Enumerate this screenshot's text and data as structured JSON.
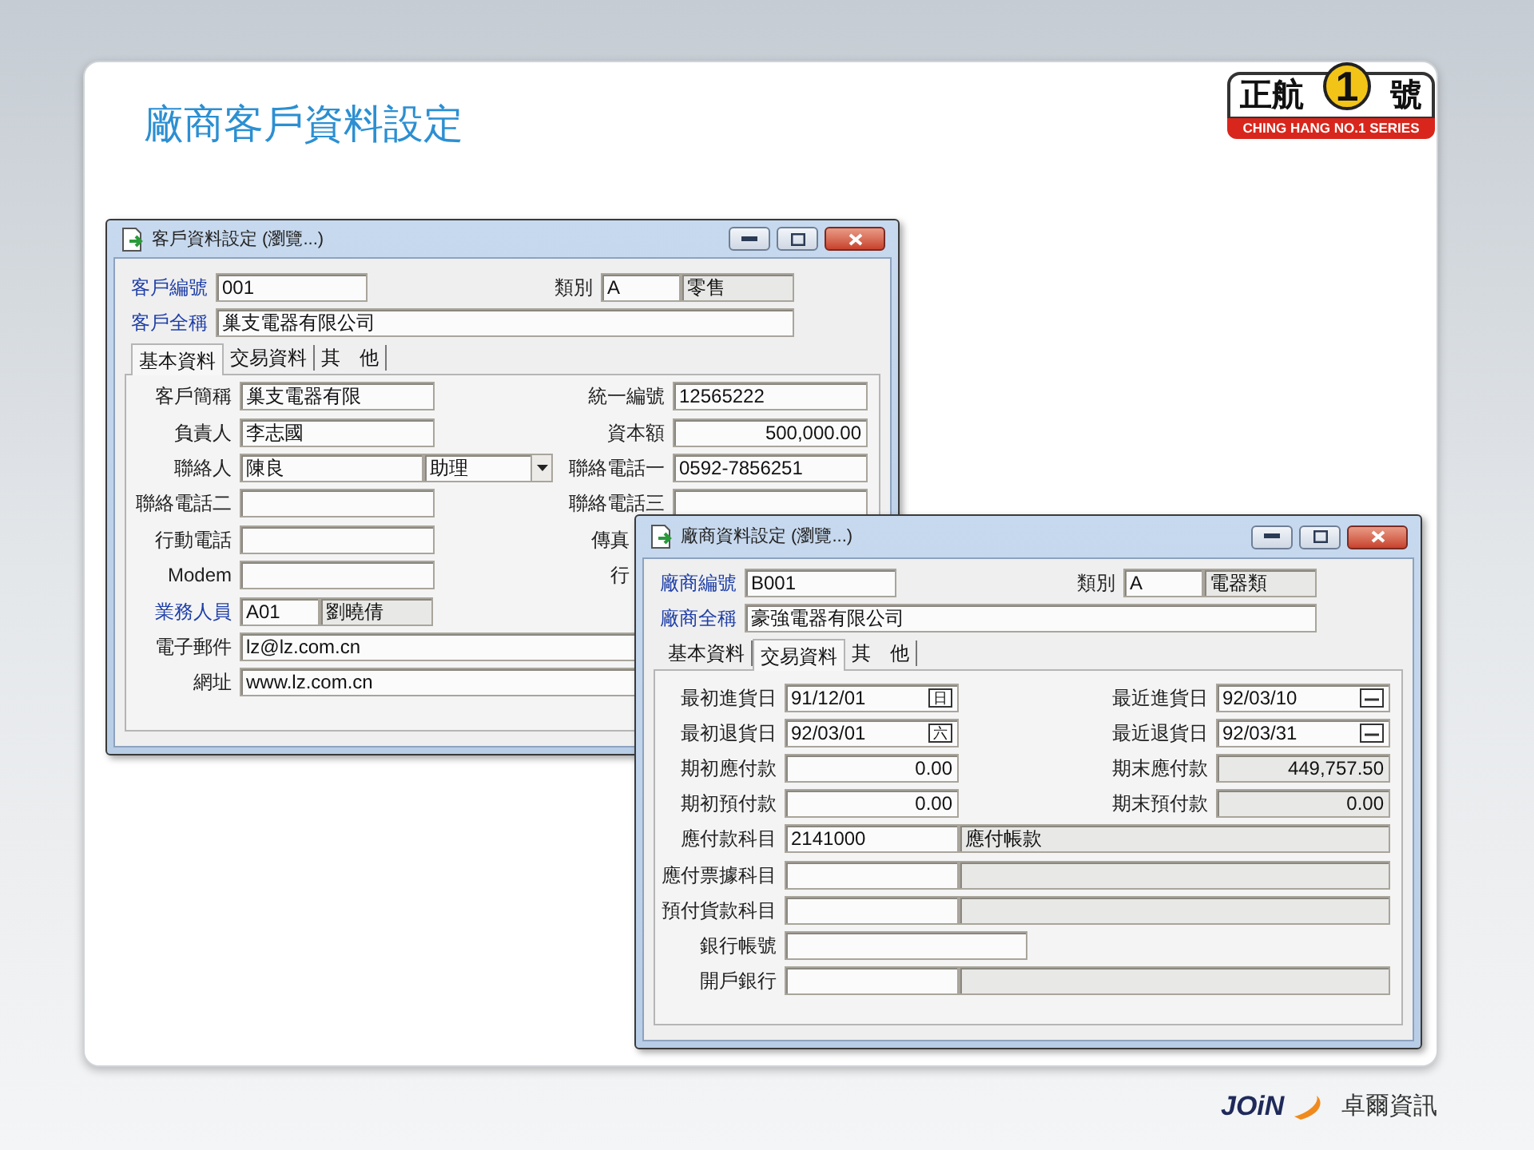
{
  "slide": {
    "title": "廠商客戶資料設定"
  },
  "logo": {
    "brand": "正航",
    "number": "1",
    "suffix": "號",
    "tagline": "CHING HANG NO.1 SERIES"
  },
  "windows": [
    {
      "kind": "customer",
      "title": "客戶資料設定 (瀏覽...)",
      "header": [
        {
          "left": {
            "label": "客戶編號",
            "linked": true,
            "fields": [
              {
                "kind": "id",
                "value": "001",
                "readonly": false
              }
            ]
          },
          "right": {
            "label": "類別",
            "linked": false,
            "fields": [
              {
                "kind": "code",
                "value": "A",
                "readonly": false
              },
              {
                "kind": "name",
                "value": "零售",
                "readonly": true
              }
            ]
          }
        },
        {
          "left": {
            "label": "客戶全稱",
            "linked": true,
            "fields": [
              {
                "kind": "wide",
                "value": "巢支電器有限公司",
                "readonly": false
              }
            ]
          }
        }
      ],
      "tabs": [
        {
          "label": "基本資料",
          "selected": true
        },
        {
          "label": "交易資料",
          "selected": false
        },
        {
          "label": "其　他",
          "selected": false
        }
      ],
      "rows": [
        {
          "left": {
            "label": "客戶簡稱",
            "linked": false,
            "fields": [
              {
                "kind": "text",
                "value": "巢支電器有限",
                "readonly": false
              }
            ]
          },
          "right": {
            "label": "統一編號",
            "linked": false,
            "fields": [
              {
                "kind": "text",
                "value": "12565222",
                "readonly": false
              }
            ]
          }
        },
        {
          "left": {
            "label": "負責人",
            "linked": false,
            "fields": [
              {
                "kind": "text",
                "value": "李志國",
                "readonly": false
              }
            ]
          },
          "right": {
            "label": "資本額",
            "linked": false,
            "fields": [
              {
                "kind": "amount",
                "value": "500,000.00",
                "readonly": false
              }
            ]
          }
        },
        {
          "left": {
            "label": "聯絡人",
            "linked": false,
            "fields": [
              {
                "kind": "text",
                "value": "陳良",
                "readonly": false
              },
              {
                "kind": "select",
                "value": "助理",
                "readonly": false
              }
            ]
          },
          "right": {
            "label": "聯絡電話一",
            "linked": false,
            "fields": [
              {
                "kind": "text",
                "value": "0592-7856251",
                "readonly": false
              }
            ]
          }
        },
        {
          "left": {
            "label": "聯絡電話二",
            "linked": false,
            "fields": [
              {
                "kind": "text",
                "readonly": false
              }
            ]
          },
          "right": {
            "label": "聯絡電話三",
            "linked": false,
            "fields": [
              {
                "kind": "text",
                "readonly": false
              }
            ]
          }
        },
        {
          "left": {
            "label": "行動電話",
            "linked": false,
            "fields": [
              {
                "kind": "text",
                "readonly": false
              }
            ]
          },
          "right": {
            "label": "傳真",
            "linked": false
          }
        },
        {
          "left": {
            "label": "Modem",
            "linked": false,
            "fields": [
              {
                "kind": "text",
                "readonly": false
              }
            ]
          },
          "right": {
            "label": "行",
            "linked": false
          }
        },
        {
          "left": {
            "label": "業務人員",
            "linked": true,
            "fields": [
              {
                "kind": "code",
                "value": "A01",
                "readonly": false
              },
              {
                "kind": "name",
                "value": "劉曉倩",
                "readonly": true
              }
            ]
          }
        },
        {
          "left": {
            "label": "電子郵件",
            "linked": false,
            "fields": [
              {
                "kind": "wide",
                "value": "lz@lz.com.cn",
                "readonly": false
              }
            ]
          }
        },
        {
          "left": {
            "label": "網址",
            "linked": false,
            "fields": [
              {
                "kind": "wide",
                "value": "www.lz.com.cn",
                "readonly": false
              }
            ]
          }
        }
      ]
    },
    {
      "kind": "vendor",
      "title": "廠商資料設定 (瀏覽...)",
      "header": [
        {
          "left": {
            "label": "廠商編號",
            "linked": true,
            "fields": [
              {
                "kind": "id",
                "value": "B001",
                "readonly": false
              }
            ]
          },
          "right": {
            "label": "類別",
            "linked": false,
            "fields": [
              {
                "kind": "code",
                "value": "A",
                "readonly": false
              },
              {
                "kind": "name",
                "value": "電器類",
                "readonly": true
              }
            ]
          }
        },
        {
          "left": {
            "label": "廠商全稱",
            "linked": true,
            "fields": [
              {
                "kind": "wide",
                "value": "豪強電器有限公司",
                "readonly": false
              }
            ]
          }
        }
      ],
      "tabs": [
        {
          "label": "基本資料",
          "selected": false
        },
        {
          "label": "交易資料",
          "selected": true
        },
        {
          "label": "其　他",
          "selected": false
        }
      ],
      "rows": [
        {
          "left": {
            "label": "最初進貨日",
            "linked": false,
            "fields": [
              {
                "kind": "date",
                "value": "91/12/01",
                "weekday": "日",
                "readonly": false
              }
            ]
          },
          "right": {
            "label": "最近進貨日",
            "linked": false,
            "fields": [
              {
                "kind": "date",
                "value": "92/03/10",
                "readonly": false
              }
            ]
          }
        },
        {
          "left": {
            "label": "最初退貨日",
            "linked": false,
            "fields": [
              {
                "kind": "date",
                "value": "92/03/01",
                "weekday": "六",
                "readonly": false
              }
            ]
          },
          "right": {
            "label": "最近退貨日",
            "linked": false,
            "fields": [
              {
                "kind": "date",
                "value": "92/03/31",
                "readonly": false
              }
            ]
          }
        },
        {
          "left": {
            "label": "期初應付款",
            "linked": false,
            "fields": [
              {
                "kind": "amount",
                "value": "0.00",
                "readonly": false
              }
            ]
          },
          "right": {
            "label": "期末應付款",
            "linked": false,
            "fields": [
              {
                "kind": "amount",
                "value": "449,757.50",
                "readonly": true
              }
            ]
          }
        },
        {
          "left": {
            "label": "期初預付款",
            "linked": false,
            "fields": [
              {
                "kind": "amount",
                "value": "0.00",
                "readonly": false
              }
            ]
          },
          "right": {
            "label": "期末預付款",
            "linked": false,
            "fields": [
              {
                "kind": "amount",
                "value": "0.00",
                "readonly": true
              }
            ]
          }
        },
        {
          "left": {
            "label": "應付款科目",
            "linked": false,
            "fields": [
              {
                "kind": "text",
                "value": "2141000",
                "readonly": false
              },
              {
                "kind": "wide",
                "value": "應付帳款",
                "readonly": true
              }
            ]
          }
        },
        {
          "left": {
            "label": "應付票據科目",
            "linked": false,
            "fields": [
              {
                "kind": "text",
                "readonly": false
              },
              {
                "kind": "wide",
                "readonly": true
              }
            ]
          }
        },
        {
          "left": {
            "label": "預付貨款科目",
            "linked": false,
            "fields": [
              {
                "kind": "text",
                "readonly": false
              },
              {
                "kind": "wide",
                "readonly": true
              }
            ]
          }
        },
        {
          "left": {
            "label": "銀行帳號",
            "linked": false,
            "fields": [
              {
                "kind": "medium",
                "readonly": false
              }
            ]
          }
        },
        {
          "left": {
            "label": "開戶銀行",
            "linked": false,
            "fields": [
              {
                "kind": "text",
                "readonly": false
              },
              {
                "kind": "wide",
                "readonly": true
              }
            ]
          }
        }
      ]
    }
  ],
  "footer_logo": {
    "mark": "JOiN",
    "company": "卓爾資訊"
  }
}
